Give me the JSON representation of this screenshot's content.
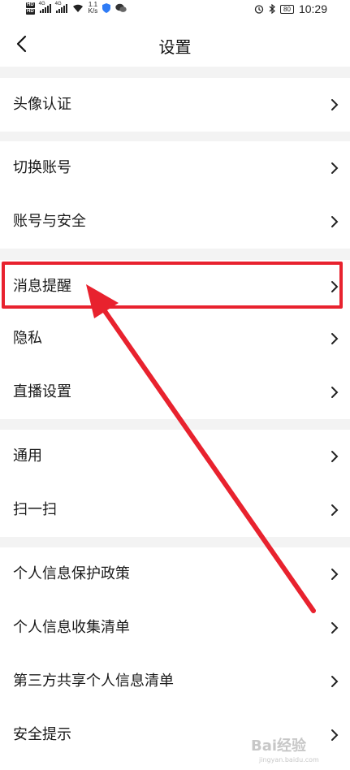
{
  "status_bar": {
    "badge_top": "HD",
    "badge_bottom": "HD",
    "network_1": "4G",
    "network_2": "4G",
    "speed_value": "1.1",
    "speed_unit": "K/s",
    "battery": "80",
    "time": "10:29"
  },
  "header": {
    "title": "设置"
  },
  "groups": [
    {
      "items": [
        {
          "label": "头像认证"
        }
      ]
    },
    {
      "items": [
        {
          "label": "切换账号"
        },
        {
          "label": "账号与安全"
        }
      ]
    },
    {
      "items": [
        {
          "label": "消息提醒"
        },
        {
          "label": "隐私"
        },
        {
          "label": "直播设置"
        }
      ]
    },
    {
      "items": [
        {
          "label": "通用"
        },
        {
          "label": "扫一扫"
        }
      ]
    },
    {
      "items": [
        {
          "label": "个人信息保护政策"
        },
        {
          "label": "个人信息收集清单"
        },
        {
          "label": "第三方共享个人信息清单"
        },
        {
          "label": "安全提示"
        }
      ]
    }
  ],
  "annotation": {
    "color": "#e8222e",
    "highlighted_item": "消息提醒"
  },
  "watermark": {
    "text": "Bai经验",
    "sub": "jingyan.baidu.com"
  },
  "icons": {
    "back": "back-arrow-icon",
    "chevron": "chevron-right-icon",
    "alarm": "alarm-icon",
    "bluetooth": "bluetooth-icon",
    "wifi": "wifi-icon",
    "shield": "shield-icon",
    "wechat": "wechat-icon"
  }
}
